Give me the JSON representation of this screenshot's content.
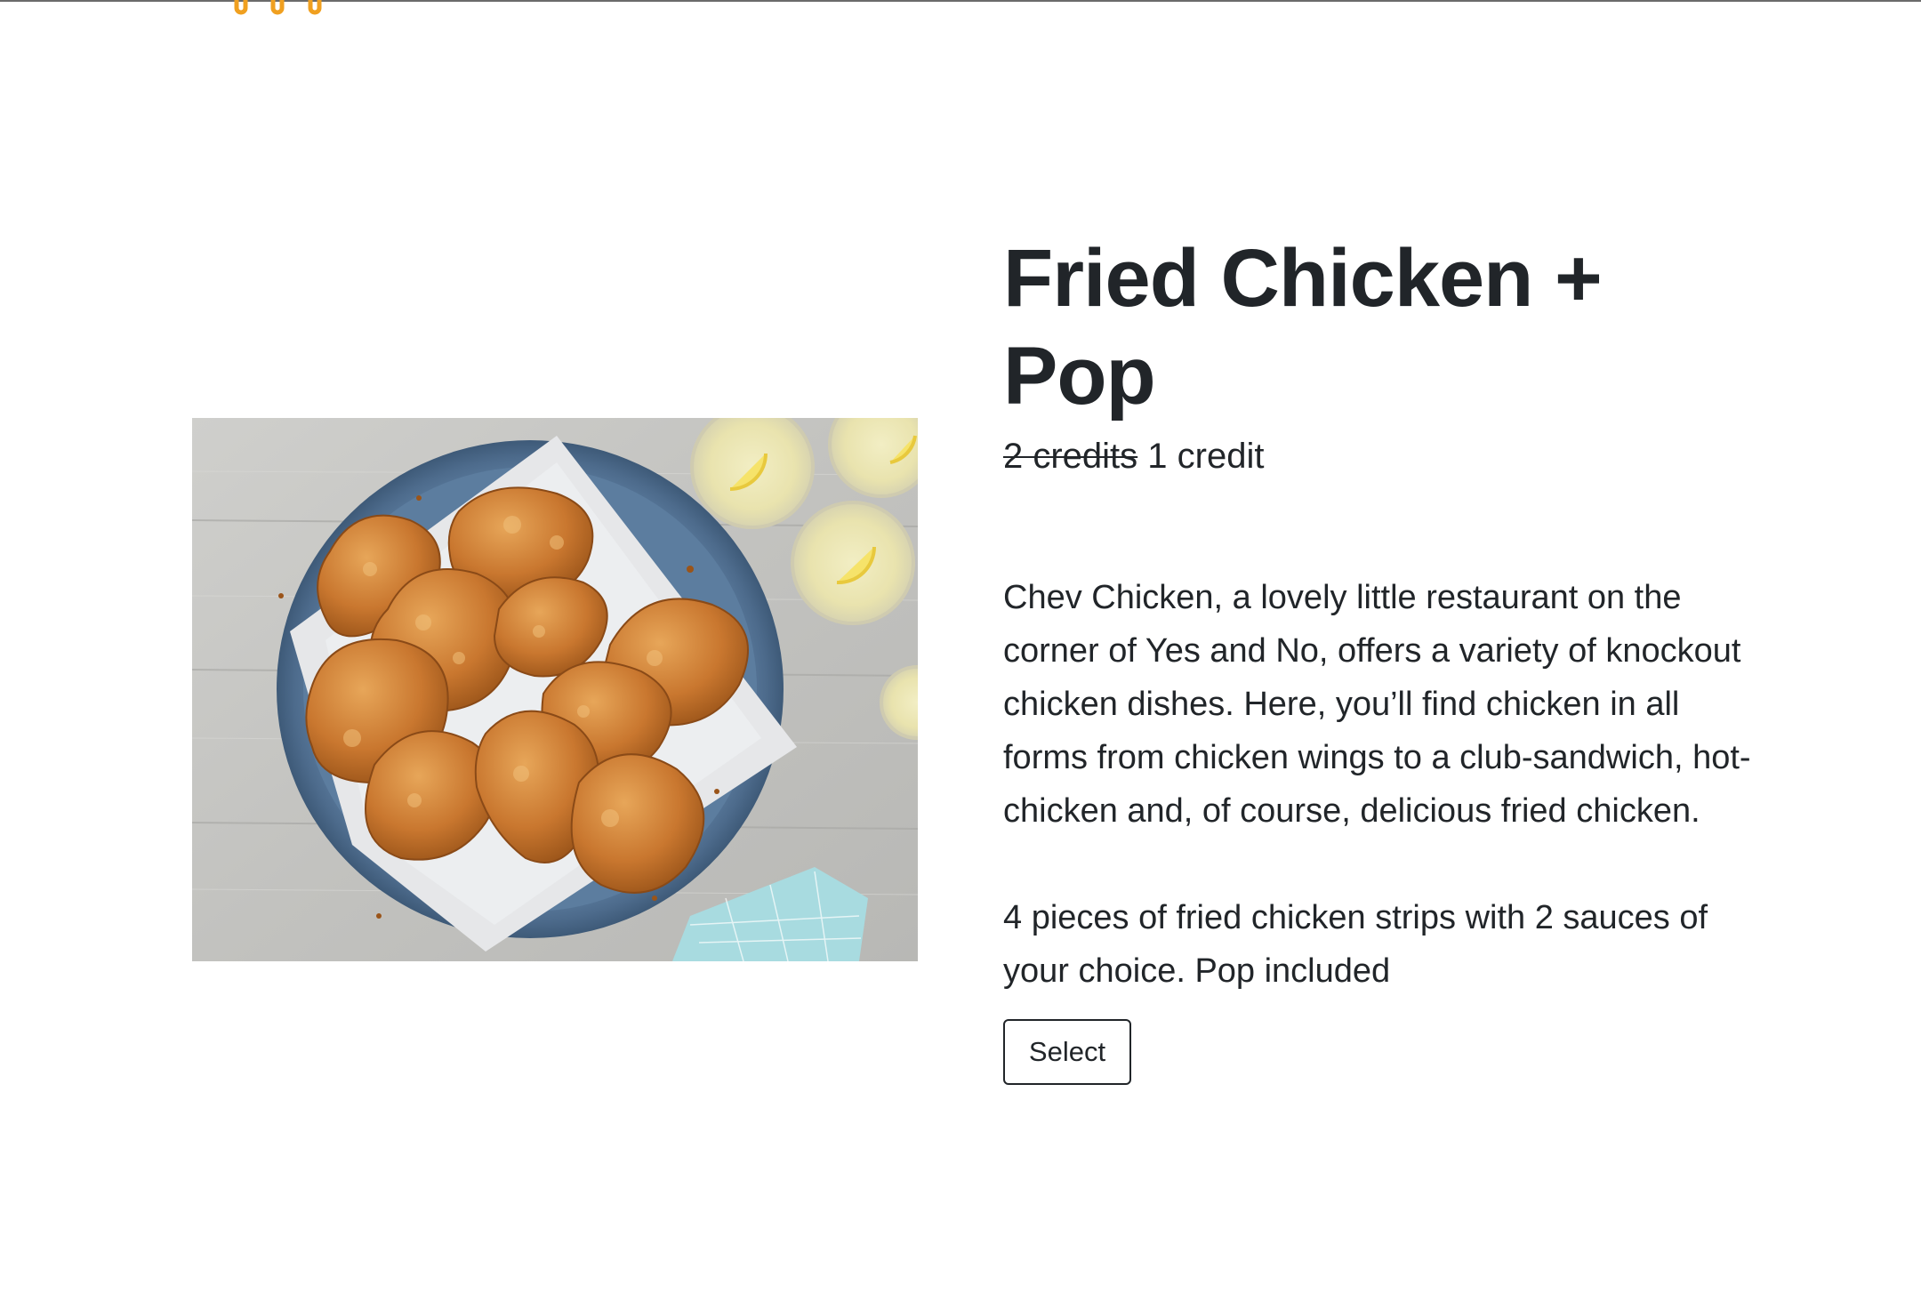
{
  "header": {
    "logo_icon": "logo-icon",
    "accent_color": "#F0A020"
  },
  "product": {
    "image_alt": "Plate of fried chicken with lemonade",
    "title": "Fried Chicken + Pop",
    "price_old": "2 credits",
    "price_new": "1 credit",
    "description": "Chev Chicken, a lovely little restaurant on the corner of Yes and No, offers a variety of knockout chicken dishes. Here, you’ll find chicken in all forms from chicken wings to a club-sandwich, hot-chicken and, of course, delicious fried chicken.",
    "details": "4 pieces of fried chicken strips with 2 sauces of your choice. Pop included",
    "select_label": "Select"
  },
  "colors": {
    "text": "#212529",
    "background": "#FFFFFF",
    "border": "#212529"
  }
}
